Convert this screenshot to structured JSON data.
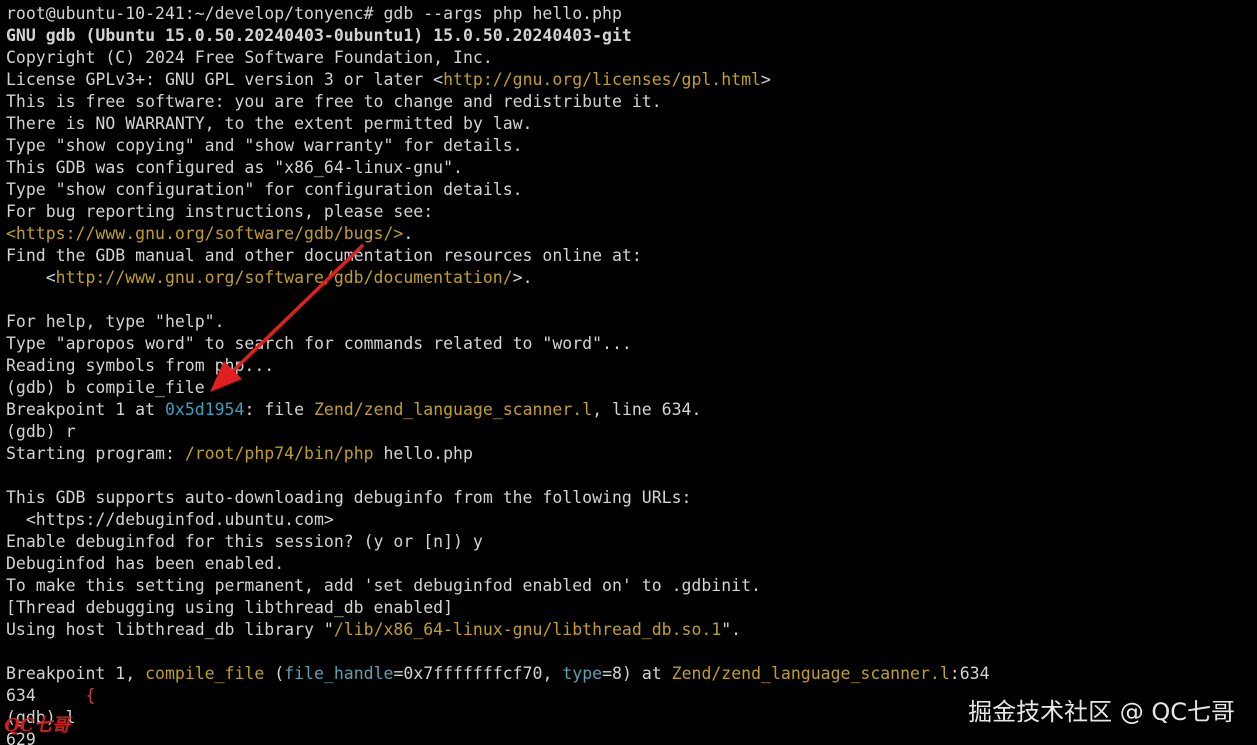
{
  "colors": {
    "background": "#000000",
    "text": "#d3d3d3",
    "yellow": "#c0a020",
    "cyan": "#3aa0c0",
    "teal": "#5fa0b0",
    "red": "#d04040",
    "arrow": "#e02020",
    "mark": "#d02020"
  },
  "lines": [
    {
      "segments": [
        {
          "text": "root@ubuntu-10-241:~/develop/tonyenc# gdb --args php hello.php"
        }
      ]
    },
    {
      "segments": [
        {
          "text": "GNU gdb (Ubuntu 15.0.50.20240403-0ubuntu1) 15.0.50.20240403-git",
          "bold": true
        }
      ]
    },
    {
      "segments": [
        {
          "text": "Copyright (C) 2024 Free Software Foundation, Inc."
        }
      ]
    },
    {
      "segments": [
        {
          "text": "License GPLv3+: GNU GPL version 3 or later <"
        },
        {
          "text": "http://gnu.org/licenses/gpl.html",
          "color": "yellow"
        },
        {
          "text": ">"
        }
      ]
    },
    {
      "segments": [
        {
          "text": "This is free software: you are free to change and redistribute it."
        }
      ]
    },
    {
      "segments": [
        {
          "text": "There is NO WARRANTY, to the extent permitted by law."
        }
      ]
    },
    {
      "segments": [
        {
          "text": "Type \"show copying\" and \"show warranty\" for details."
        }
      ]
    },
    {
      "segments": [
        {
          "text": "This GDB was configured as \"x86_64-linux-gnu\"."
        }
      ]
    },
    {
      "segments": [
        {
          "text": "Type \"show configuration\" for configuration details."
        }
      ]
    },
    {
      "segments": [
        {
          "text": "For bug reporting instructions, please see:"
        }
      ]
    },
    {
      "segments": [
        {
          "text": "<https://www.gnu.org/software/gdb/bugs/>",
          "color": "yellow"
        },
        {
          "text": "."
        }
      ]
    },
    {
      "segments": [
        {
          "text": "Find the GDB manual and other documentation resources online at:"
        }
      ]
    },
    {
      "segments": [
        {
          "text": "    <"
        },
        {
          "text": "http://www.gnu.org/software/gdb/documentation/",
          "color": "yellow"
        },
        {
          "text": ">."
        }
      ]
    },
    {
      "segments": [
        {
          "text": ""
        }
      ]
    },
    {
      "segments": [
        {
          "text": "For help, type \"help\"."
        }
      ]
    },
    {
      "segments": [
        {
          "text": "Type \"apropos word\" to search for commands related to \"word\"..."
        }
      ]
    },
    {
      "segments": [
        {
          "text": "Reading symbols from php..."
        }
      ]
    },
    {
      "segments": [
        {
          "text": "(gdb) b compile_file"
        }
      ]
    },
    {
      "segments": [
        {
          "text": "Breakpoint 1 at "
        },
        {
          "text": "0x5d1954",
          "color": "cyan"
        },
        {
          "text": ": file "
        },
        {
          "text": "Zend/zend_language_scanner.l",
          "color": "yellow"
        },
        {
          "text": ", line 634."
        }
      ]
    },
    {
      "segments": [
        {
          "text": "(gdb) r"
        }
      ]
    },
    {
      "segments": [
        {
          "text": "Starting program: "
        },
        {
          "text": "/root/php74/bin/php",
          "color": "yellow"
        },
        {
          "text": " hello.php"
        }
      ]
    },
    {
      "segments": [
        {
          "text": ""
        }
      ]
    },
    {
      "segments": [
        {
          "text": "This GDB supports auto-downloading debuginfo from the following URLs:"
        }
      ]
    },
    {
      "segments": [
        {
          "text": "  <https://debuginfod.ubuntu.com>"
        }
      ]
    },
    {
      "segments": [
        {
          "text": "Enable debuginfod for this session? (y or [n]) y"
        }
      ]
    },
    {
      "segments": [
        {
          "text": "Debuginfod has been enabled."
        }
      ]
    },
    {
      "segments": [
        {
          "text": "To make this setting permanent, add 'set debuginfod enabled on' to .gdbinit."
        }
      ]
    },
    {
      "segments": [
        {
          "text": "[Thread debugging using libthread_db enabled]"
        }
      ]
    },
    {
      "segments": [
        {
          "text": "Using host libthread_db library \""
        },
        {
          "text": "/lib/x86_64-linux-gnu/libthread_db.so.1",
          "color": "yellow"
        },
        {
          "text": "\"."
        }
      ]
    },
    {
      "segments": [
        {
          "text": ""
        }
      ]
    },
    {
      "segments": [
        {
          "text": "Breakpoint 1, "
        },
        {
          "text": "compile_file",
          "color": "yellow"
        },
        {
          "text": " ("
        },
        {
          "text": "file_handle",
          "color": "teal"
        },
        {
          "text": "=0x7fffffffcf70, "
        },
        {
          "text": "type",
          "color": "teal"
        },
        {
          "text": "=8) at "
        },
        {
          "text": "Zend/zend_language_scanner.l",
          "color": "yellow"
        },
        {
          "text": ":634"
        }
      ]
    },
    {
      "segments": [
        {
          "text": "634     "
        },
        {
          "text": "{",
          "color": "red"
        }
      ]
    },
    {
      "segments": [
        {
          "text": "(gdb) l"
        }
      ]
    },
    {
      "segments": [
        {
          "text": "629"
        }
      ]
    }
  ],
  "watermark": "掘金技术社区 @ QC七哥",
  "corner_mark": "QC七哥",
  "arrow_icon": "red-annotation-arrow"
}
